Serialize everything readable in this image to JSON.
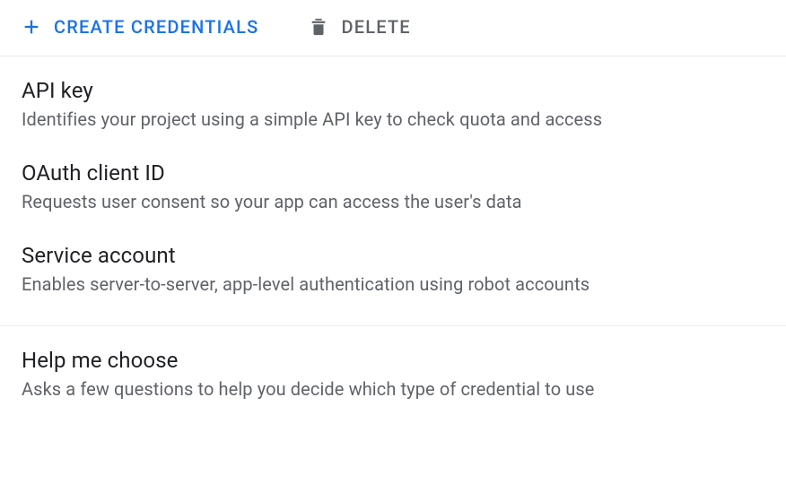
{
  "toolbar": {
    "create_label": "CREATE CREDENTIALS",
    "delete_label": "DELETE"
  },
  "menu": {
    "items": [
      {
        "title": "API key",
        "desc": "Identifies your project using a simple API key to check quota and access"
      },
      {
        "title": "OAuth client ID",
        "desc": "Requests user consent so your app can access the user's data"
      },
      {
        "title": "Service account",
        "desc": "Enables server-to-server, app-level authentication using robot accounts"
      }
    ],
    "help": {
      "title": "Help me choose",
      "desc": "Asks a few questions to help you decide which type of credential to use"
    }
  }
}
